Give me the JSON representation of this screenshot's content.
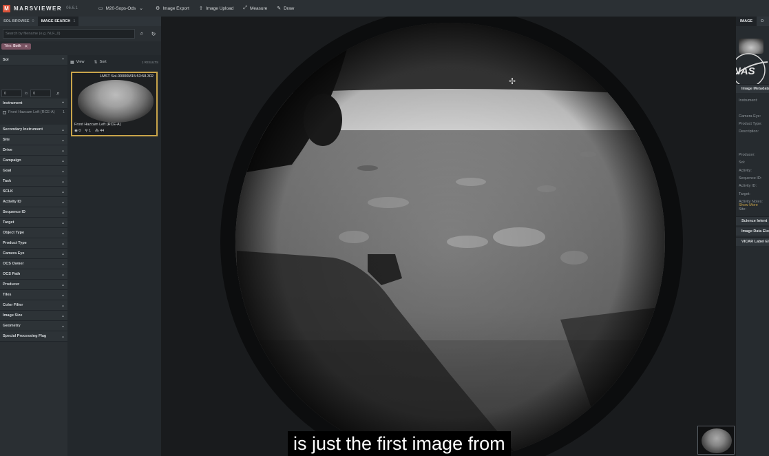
{
  "app": {
    "name": "MARSVIEWER",
    "version": "06.6.1",
    "logo_letter": "M",
    "brand_color": "#d9523a"
  },
  "toolbar": {
    "project": {
      "icon": "folder-icon",
      "label": "M20-Sops-Ods"
    },
    "items": [
      {
        "icon": "image-export-icon",
        "label": "Image Export"
      },
      {
        "icon": "upload-icon",
        "label": "Image Upload"
      },
      {
        "icon": "measure-icon",
        "label": "Measure"
      },
      {
        "icon": "pencil-icon",
        "label": "Draw"
      }
    ]
  },
  "left_tabs": [
    {
      "label": "SOL BROWSE",
      "count": "0"
    },
    {
      "label": "IMAGE SEARCH",
      "count": "1"
    }
  ],
  "search": {
    "placeholder": "Search by filename (e.g. NLF_0)"
  },
  "filter_chip": {
    "prefix": "Tiles:",
    "value": "Both",
    "color": "#7a5463"
  },
  "sol_facet": {
    "label": "Sol",
    "min": "0",
    "to": "to",
    "max": "0"
  },
  "instrument_facet": {
    "label": "Instrument",
    "items": [
      {
        "label": "Front Hazcam Left (RCE-A)",
        "count": "1"
      }
    ]
  },
  "facets": [
    "Secondary Instrument",
    "Site",
    "Drive",
    "Campaign",
    "Goal",
    "Task",
    "SCLK",
    "Activity ID",
    "Sequence ID",
    "Target",
    "Object Type",
    "Product Type",
    "Camera Eye",
    "OCS Owner",
    "OCS Path",
    "Producer",
    "Tiles",
    "Color Filter",
    "Image Size",
    "Geometry",
    "Special Processing Flag"
  ],
  "results": {
    "view_label": "View",
    "sort_label": "Sort",
    "count_label": "1 RESULTS",
    "selected_color": "#c9a44a",
    "item": {
      "caption": "LMST Sol-00000M15:53:58.302",
      "title": "Front Hazcam Left (RCE-A)",
      "stats": [
        "0",
        "1",
        "44"
      ]
    }
  },
  "subtitle": "is just the first image from",
  "right_tabs": [
    "IMAGE",
    "O"
  ],
  "right_panel": {
    "section_title": "Image Metadata",
    "fields": [
      "Instrument:",
      "",
      "Camera Eye:",
      "Product Type:",
      "Description:",
      "",
      "",
      "Producer:",
      "Sol:",
      "Activity:",
      "Sequence ID:",
      "Activity ID:",
      "Target:",
      "Activity Notes:",
      "Site:"
    ],
    "show_more": "Show More",
    "sections": [
      "Science Intent",
      "Image Data Elements",
      "VICAR Label Elements"
    ]
  }
}
